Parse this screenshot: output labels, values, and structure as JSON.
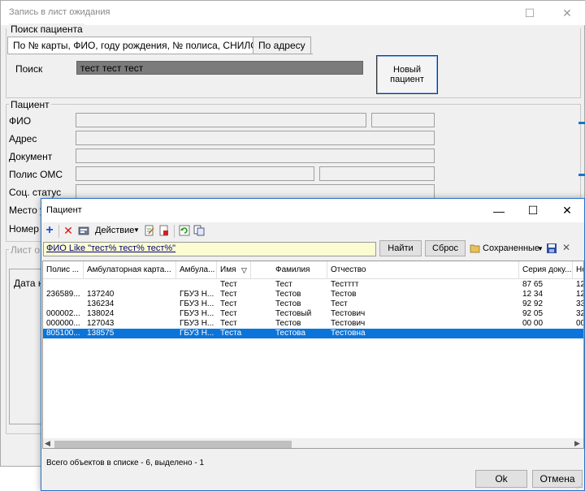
{
  "background_window": {
    "title": "Запись в лист ожидания",
    "search_group_label": "Поиск пациента",
    "tabs": [
      {
        "label": "По № карты, ФИО, году рождения, № полиса, СНИЛС"
      },
      {
        "label": "По адресу"
      }
    ],
    "search_label": "Поиск",
    "search_value": "тест тест тест",
    "new_patient_button": "Новый пациент",
    "patient_group_label": "Пациент",
    "patient_fields": {
      "fio": "ФИО",
      "address": "Адрес",
      "document": "Документ",
      "oms_policy": "Полис ОМС",
      "social_status": "Соц. статус",
      "place_truncated": "Место у",
      "number_truncated": "Номер"
    },
    "waitlist_group_truncated": "Лист о",
    "date_column_truncated": "Дата н"
  },
  "dialog": {
    "title": "Пациент",
    "toolbar": {
      "add_icon": "plus-icon",
      "delete_icon": "delete-x-icon",
      "action_menu_label": "Действие",
      "icons": [
        "properties-icon",
        "edit-doc-icon",
        "export-doc-icon",
        "refresh-icon",
        "copy-icon"
      ]
    },
    "filter_text": "ФИО Like \"тест% тест% тест%\"",
    "find_button": "Найти",
    "reset_button": "Сброс",
    "saved_button": "Сохраненные",
    "columns": [
      "Полис ...",
      "Амбулаторная карта...",
      "Амбула...",
      "Имя",
      "Фамилия",
      "Отчество",
      "Серия доку...",
      "Но"
    ],
    "rows": [
      {
        "polis": "",
        "card": "",
        "amb": "",
        "name": "Тест",
        "surname": "Тест",
        "patronymic": "Тестттт",
        "doc_series": "87 65",
        "num": "12",
        "selected": false
      },
      {
        "polis": "236589...",
        "card": "137240",
        "amb": "ГБУЗ Н...",
        "name": "Тест",
        "surname": "Тестов",
        "patronymic": "Тестов",
        "doc_series": "12 34",
        "num": "12",
        "selected": false
      },
      {
        "polis": "",
        "card": "136234",
        "amb": "ГБУЗ Н...",
        "name": "Тест",
        "surname": "Тестов",
        "patronymic": "Тест",
        "doc_series": "92 92",
        "num": "33",
        "selected": false
      },
      {
        "polis": "000002...",
        "card": "138024",
        "amb": "ГБУЗ Н...",
        "name": "Тест",
        "surname": "Тестовый",
        "patronymic": "Тестович",
        "doc_series": "92 05",
        "num": "32",
        "selected": false
      },
      {
        "polis": "000000...",
        "card": "127043",
        "amb": "ГБУЗ Н...",
        "name": "Тест",
        "surname": "Тестов",
        "patronymic": "Тестович",
        "doc_series": "00 00",
        "num": "00",
        "selected": false
      },
      {
        "polis": "805100...",
        "card": "138575",
        "amb": "ГБУЗ Н...",
        "name": "Теста",
        "surname": "Тестова",
        "patronymic": "Тестовна",
        "doc_series": "",
        "num": "",
        "selected": true
      }
    ],
    "status_text": "Всего объектов в списке - 6, выделено - 1",
    "ok_button": "Ok",
    "cancel_button": "Отмена"
  },
  "colors": {
    "selection": "#0a74da",
    "dialog_border": "#2a72c9",
    "filter_bg": "#fcfcd2",
    "search_field_bg": "#7b7b7b"
  }
}
